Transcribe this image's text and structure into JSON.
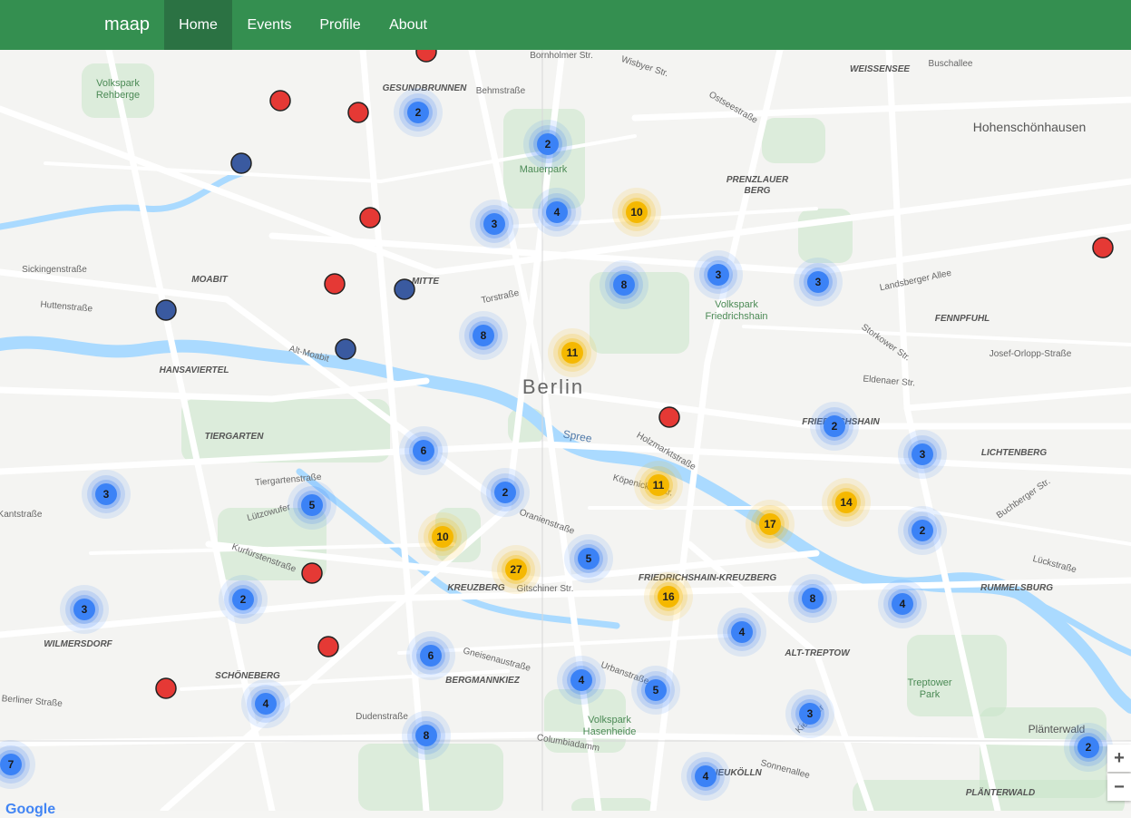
{
  "navbar": {
    "brand": "maap",
    "items": [
      {
        "label": "Home",
        "active": true
      },
      {
        "label": "Events",
        "active": false
      },
      {
        "label": "Profile",
        "active": false
      },
      {
        "label": "About",
        "active": false
      }
    ]
  },
  "colors": {
    "navbar": "#348f50",
    "navbar_active": "#2b7243",
    "cluster_small": "#3b82f6",
    "cluster_large": "#f5b800",
    "marker_red": "#e53935",
    "marker_navy": "#3a5aa0",
    "water": "#aadaff",
    "park": "#c8e6c9"
  },
  "map": {
    "city_label": "Berlin",
    "zoom_in_label": "+",
    "zoom_out_label": "−",
    "attribution": "Google",
    "labels": [
      {
        "text": "Volkspark\nRehberge",
        "kind": "park"
      },
      {
        "text": "GESUNDBRUNNEN",
        "kind": "district"
      },
      {
        "text": "Behmstraße",
        "kind": "street"
      },
      {
        "text": "Bornholmer Str.",
        "kind": "street"
      },
      {
        "text": "Wisbyer Str.",
        "kind": "street"
      },
      {
        "text": "WEISSENSEE",
        "kind": "district"
      },
      {
        "text": "Buschallee",
        "kind": "street"
      },
      {
        "text": "Hohenschönhausen",
        "kind": "area"
      },
      {
        "text": "Mauerpark",
        "kind": "park"
      },
      {
        "text": "PRENZLAUER\nBERG",
        "kind": "district"
      },
      {
        "text": "Volkspark\nFriedrichshain",
        "kind": "park"
      },
      {
        "text": "MOABIT",
        "kind": "district"
      },
      {
        "text": "MITTE",
        "kind": "district"
      },
      {
        "text": "Torstraße",
        "kind": "street"
      },
      {
        "text": "HANSAVIERTEL",
        "kind": "district"
      },
      {
        "text": "TIERGARTEN",
        "kind": "district"
      },
      {
        "text": "Tiergartenstraße",
        "kind": "street"
      },
      {
        "text": "Lützowufer",
        "kind": "street"
      },
      {
        "text": "Kurfürstenstraße",
        "kind": "street"
      },
      {
        "text": "KREUZBERG",
        "kind": "district"
      },
      {
        "text": "Gitschiner Str.",
        "kind": "street"
      },
      {
        "text": "FRIEDRICHSHAIN-KREUZBERG",
        "kind": "district"
      },
      {
        "text": "FRIEDRICHSHAIN",
        "kind": "district"
      },
      {
        "text": "LICHTENBERG",
        "kind": "district"
      },
      {
        "text": "FENNPFUHL",
        "kind": "district"
      },
      {
        "text": "RUMMELSBURG",
        "kind": "district"
      },
      {
        "text": "ALT-TREPTOW",
        "kind": "district"
      },
      {
        "text": "Treptower\nPark",
        "kind": "park"
      },
      {
        "text": "WILMERSDORF",
        "kind": "district"
      },
      {
        "text": "SCHÖNEBERG",
        "kind": "district"
      },
      {
        "text": "BERGMANNKIEZ",
        "kind": "district"
      },
      {
        "text": "Volkspark\nHasenheide",
        "kind": "park"
      },
      {
        "text": "NEUKÖLLN",
        "kind": "district"
      },
      {
        "text": "Plänterwald",
        "kind": "area"
      },
      {
        "text": "PLÄNTERWALD",
        "kind": "district"
      },
      {
        "text": "Spree",
        "kind": "water"
      },
      {
        "text": "Landsberger Allee",
        "kind": "street"
      },
      {
        "text": "Storkower Str.",
        "kind": "street"
      },
      {
        "text": "Josef-Orlopp-Straße",
        "kind": "street"
      },
      {
        "text": "Eldenaer Str.",
        "kind": "street"
      },
      {
        "text": "Buchberger Str.",
        "kind": "street"
      },
      {
        "text": "Lückstraße",
        "kind": "street"
      },
      {
        "text": "Oranienstraße",
        "kind": "street"
      },
      {
        "text": "Gneisenaustraße",
        "kind": "street"
      },
      {
        "text": "Urbanstraße",
        "kind": "street"
      },
      {
        "text": "Dudenstraße",
        "kind": "street"
      },
      {
        "text": "Columbiadamm",
        "kind": "street"
      },
      {
        "text": "Berliner Straße",
        "kind": "street"
      },
      {
        "text": "Kantstraße",
        "kind": "street"
      },
      {
        "text": "Sickingenstraße",
        "kind": "street"
      },
      {
        "text": "Huttenstraße",
        "kind": "street"
      },
      {
        "text": "Alt-Moabit",
        "kind": "street"
      },
      {
        "text": "Ostseestraße",
        "kind": "street"
      },
      {
        "text": "Holzmarktstraße",
        "kind": "street"
      },
      {
        "text": "Köpenicker Str.",
        "kind": "street"
      },
      {
        "text": "Kiehlufer",
        "kind": "street"
      },
      {
        "text": "Sonnenallee",
        "kind": "street"
      }
    ],
    "clusters": [
      {
        "count": "2",
        "size": "small"
      },
      {
        "count": "2",
        "size": "small"
      },
      {
        "count": "3",
        "size": "small"
      },
      {
        "count": "4",
        "size": "small"
      },
      {
        "count": "10",
        "size": "large"
      },
      {
        "count": "8",
        "size": "small"
      },
      {
        "count": "3",
        "size": "small"
      },
      {
        "count": "3",
        "size": "small"
      },
      {
        "count": "8",
        "size": "small"
      },
      {
        "count": "11",
        "size": "large"
      },
      {
        "count": "6",
        "size": "small"
      },
      {
        "count": "3",
        "size": "small"
      },
      {
        "count": "5",
        "size": "small"
      },
      {
        "count": "2",
        "size": "small"
      },
      {
        "count": "11",
        "size": "large"
      },
      {
        "count": "2",
        "size": "small"
      },
      {
        "count": "3",
        "size": "small"
      },
      {
        "count": "14",
        "size": "large"
      },
      {
        "count": "17",
        "size": "large"
      },
      {
        "count": "10",
        "size": "large"
      },
      {
        "count": "27",
        "size": "large"
      },
      {
        "count": "5",
        "size": "small"
      },
      {
        "count": "2",
        "size": "small"
      },
      {
        "count": "3",
        "size": "small"
      },
      {
        "count": "2",
        "size": "small"
      },
      {
        "count": "16",
        "size": "large"
      },
      {
        "count": "8",
        "size": "small"
      },
      {
        "count": "4",
        "size": "small"
      },
      {
        "count": "4",
        "size": "small"
      },
      {
        "count": "6",
        "size": "small"
      },
      {
        "count": "4",
        "size": "small"
      },
      {
        "count": "5",
        "size": "small"
      },
      {
        "count": "4",
        "size": "small"
      },
      {
        "count": "3",
        "size": "small"
      },
      {
        "count": "8",
        "size": "small"
      },
      {
        "count": "7",
        "size": "small"
      },
      {
        "count": "4",
        "size": "small"
      },
      {
        "count": "2",
        "size": "small"
      }
    ],
    "markers": [
      {
        "color": "red"
      },
      {
        "color": "red"
      },
      {
        "color": "red"
      },
      {
        "color": "navy"
      },
      {
        "color": "red"
      },
      {
        "color": "red"
      },
      {
        "color": "navy"
      },
      {
        "color": "navy"
      },
      {
        "color": "navy"
      },
      {
        "color": "red"
      },
      {
        "color": "red"
      },
      {
        "color": "red"
      },
      {
        "color": "red"
      },
      {
        "color": "red"
      }
    ]
  }
}
